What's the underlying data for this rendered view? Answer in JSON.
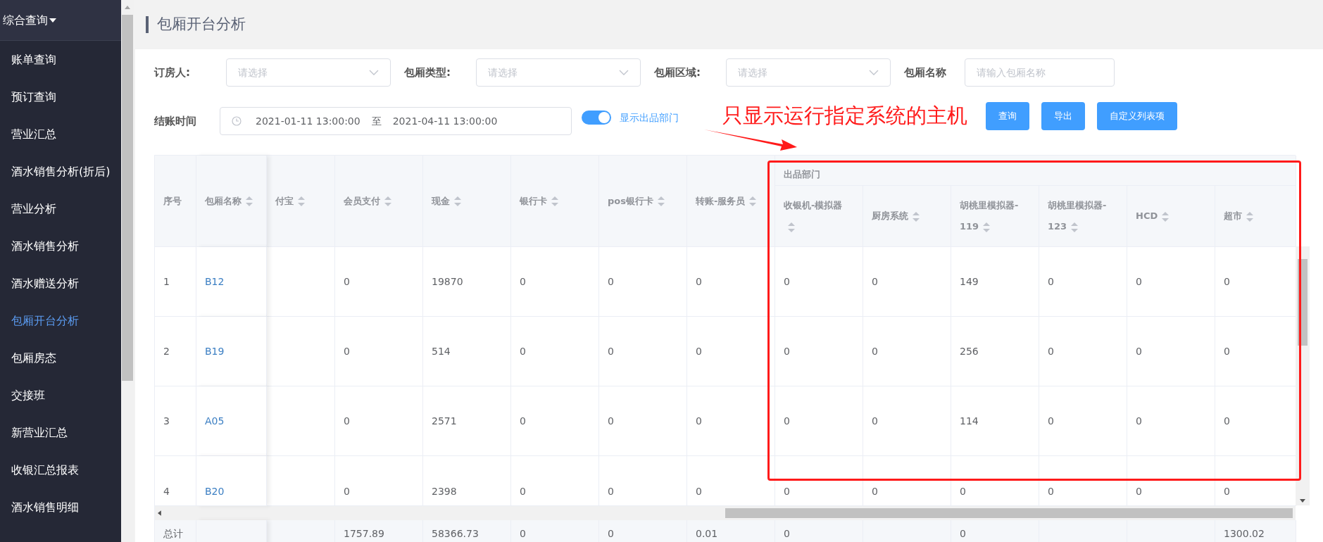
{
  "sidebar": {
    "header": "综合查询",
    "items": [
      {
        "label": "账单查询",
        "selected": false
      },
      {
        "label": "预订查询",
        "selected": false
      },
      {
        "label": "营业汇总",
        "selected": false
      },
      {
        "label": "酒水销售分析(折后)",
        "selected": false
      },
      {
        "label": "营业分析",
        "selected": false
      },
      {
        "label": "酒水销售分析",
        "selected": false
      },
      {
        "label": "酒水赠送分析",
        "selected": false
      },
      {
        "label": "包厢开台分析",
        "selected": true
      },
      {
        "label": "包厢房态",
        "selected": false
      },
      {
        "label": "交接班",
        "selected": false
      },
      {
        "label": "新营业汇总",
        "selected": false
      },
      {
        "label": "收银汇总报表",
        "selected": false
      },
      {
        "label": "酒水销售明细",
        "selected": false
      }
    ]
  },
  "page_title": "包厢开台分析",
  "filters": [
    {
      "label": "订房人:",
      "kind": "select",
      "placeholder": "请选择"
    },
    {
      "label": "包厢类型:",
      "kind": "select",
      "placeholder": "请选择"
    },
    {
      "label": "包厢区域:",
      "kind": "select",
      "placeholder": "请选择"
    },
    {
      "label": "包厢名称",
      "kind": "input",
      "placeholder": "请输入包厢名称"
    }
  ],
  "date_filter": {
    "label": "结账时间",
    "start": "2021-01-11 13:00:00",
    "separator": "至",
    "end": "2021-04-11 13:00:00"
  },
  "toggle": {
    "label": "显示出品部门",
    "on": true
  },
  "annotation": {
    "text": "只显示运行指定系统的主机"
  },
  "buttons": [
    "查询",
    "导出",
    "自定义列表项"
  ],
  "table": {
    "columns": [
      {
        "label": "序号",
        "sortable": false
      },
      {
        "label": "包厢名称",
        "sortable": true
      },
      {
        "label": "付宝",
        "sortable": true
      },
      {
        "label": "会员支付",
        "sortable": true
      },
      {
        "label": "现金",
        "sortable": true
      },
      {
        "label": "银行卡",
        "sortable": true
      },
      {
        "label": "pos银行卡",
        "sortable": true
      },
      {
        "label": "转账-服务员",
        "sortable": true
      }
    ],
    "column_group": {
      "label": "出品部门",
      "columns": [
        {
          "label": "收银机-模拟器",
          "sortable": true
        },
        {
          "label": "厨房系统",
          "sortable": true
        },
        {
          "label": "胡桃里模拟器-119",
          "sortable": true
        },
        {
          "label": "胡桃里模拟器-123",
          "sortable": true
        },
        {
          "label": "HCD",
          "sortable": true
        },
        {
          "label": "超市",
          "sortable": true
        }
      ]
    },
    "rows": [
      {
        "index": "1",
        "room": "B12",
        "member_pay": "0",
        "cash": "19870",
        "bank_card": "0",
        "pos_bank_card": "0",
        "transfer_staff": "0",
        "cashier_sim": "0",
        "kitchen": "0",
        "walnut_119": "149",
        "walnut_123": "0",
        "hcd": "0",
        "supermarket": "0"
      },
      {
        "index": "2",
        "room": "B19",
        "member_pay": "0",
        "cash": "514",
        "bank_card": "0",
        "pos_bank_card": "0",
        "transfer_staff": "0",
        "cashier_sim": "0",
        "kitchen": "0",
        "walnut_119": "256",
        "walnut_123": "0",
        "hcd": "0",
        "supermarket": "0"
      },
      {
        "index": "3",
        "room": "A05",
        "member_pay": "0",
        "cash": "2571",
        "bank_card": "0",
        "pos_bank_card": "0",
        "transfer_staff": "0",
        "cashier_sim": "0",
        "kitchen": "0",
        "walnut_119": "114",
        "walnut_123": "0",
        "hcd": "0",
        "supermarket": "0"
      },
      {
        "index": "4",
        "room": "B20",
        "member_pay": "0",
        "cash": "2398",
        "bank_card": "0",
        "pos_bank_card": "0",
        "transfer_staff": "0",
        "cashier_sim": "0",
        "kitchen": "0",
        "walnut_119": "0",
        "walnut_123": "0",
        "hcd": "0",
        "supermarket": "0"
      }
    ],
    "total": {
      "index": "总计",
      "member_pay": "1757.89",
      "cash": "58366.73",
      "bank_card": "0",
      "pos_bank_card": "0",
      "transfer_staff": "0.01",
      "cashier_sim": "0",
      "walnut_119": "0",
      "supermarket": "1300.02"
    }
  }
}
